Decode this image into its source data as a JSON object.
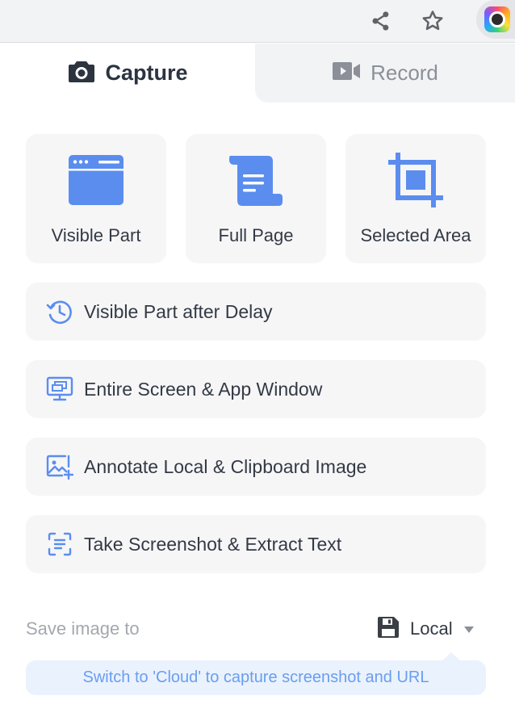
{
  "browser_toolbar": {
    "icons": [
      "share-icon",
      "bookmark-star-icon",
      "extension-icon"
    ]
  },
  "tabs": {
    "capture_label": "Capture",
    "record_label": "Record",
    "active": "Capture"
  },
  "capture_tiles": [
    {
      "label": "Visible Part",
      "icon": "browser-window-icon"
    },
    {
      "label": "Full Page",
      "icon": "scroll-page-icon"
    },
    {
      "label": "Selected Area",
      "icon": "crop-icon"
    }
  ],
  "capture_options": [
    {
      "label": "Visible Part after Delay",
      "icon": "delay-timer-icon"
    },
    {
      "label": "Entire Screen & App Window",
      "icon": "desktop-windows-icon"
    },
    {
      "label": "Annotate Local & Clipboard Image",
      "icon": "image-add-icon"
    },
    {
      "label": "Take Screenshot & Extract Text",
      "icon": "text-scan-icon"
    }
  ],
  "save": {
    "label": "Save image to",
    "value": "Local",
    "icon": "floppy-disk-icon"
  },
  "hint": "Switch to 'Cloud' to capture screenshot and URL",
  "colors": {
    "accent": "#5b8def",
    "text": "#333a45",
    "muted": "#a4a8ae",
    "tile_bg": "#f6f6f7",
    "hint_bg": "#eaf2fd"
  }
}
